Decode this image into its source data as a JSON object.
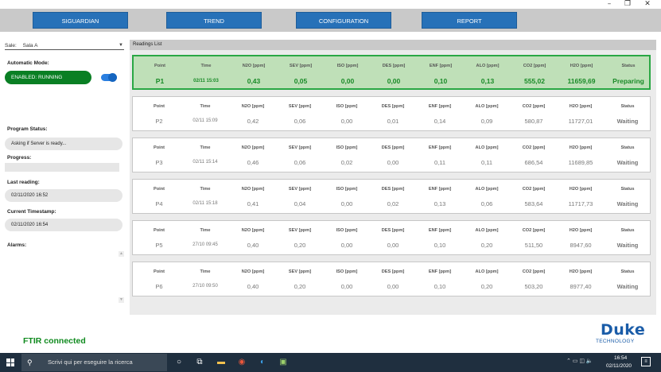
{
  "window": {
    "minimize": "–",
    "maximize": "❐",
    "close": "✕"
  },
  "nav": {
    "siguardian": "SIGUARDIAN",
    "trend": "TREND",
    "configuration": "CONFIGURATION",
    "report": "REPORT"
  },
  "left": {
    "sala_label": "Sale:",
    "sala_value": "Sala A",
    "auto_mode_label": "Automatic Mode:",
    "auto_mode_value": "ENABLED: RUNNING",
    "program_status_label": "Program Status:",
    "program_status_value": "Asking if Server is ready...",
    "progress_label": "Progress:",
    "progress_value": 0,
    "last_reading_label": "Last reading:",
    "last_reading_value": "02/11/2020 16:52",
    "current_ts_label": "Current Timestamp:",
    "current_ts_value": "02/11/2020 16:54",
    "alarms_label": "Alarms:",
    "ftir_status": "FTIR connected"
  },
  "readings": {
    "title": "Readings List",
    "columns": [
      "Point",
      "Time",
      "N2O [ppm]",
      "SEV [ppm]",
      "ISO [ppm]",
      "DES [ppm]",
      "ENF [ppm]",
      "ALO [ppm]",
      "CO2 [ppm]",
      "H2O [ppm]",
      "Status"
    ],
    "rows": [
      {
        "active": true,
        "cells": [
          "P1",
          "02/11 15:03",
          "0,43",
          "0,05",
          "0,00",
          "0,00",
          "0,10",
          "0,13",
          "555,02",
          "11659,69",
          "Preparing"
        ]
      },
      {
        "active": false,
        "cells": [
          "P2",
          "02/11 15:09",
          "0,42",
          "0,06",
          "0,00",
          "0,01",
          "0,14",
          "0,09",
          "580,87",
          "11727,01",
          "Waiting"
        ]
      },
      {
        "active": false,
        "cells": [
          "P3",
          "02/11 15:14",
          "0,46",
          "0,06",
          "0,02",
          "0,00",
          "0,11",
          "0,11",
          "686,54",
          "11689,85",
          "Waiting"
        ]
      },
      {
        "active": false,
        "cells": [
          "P4",
          "02/11 15:18",
          "0,41",
          "0,04",
          "0,00",
          "0,02",
          "0,13",
          "0,06",
          "583,64",
          "11717,73",
          "Waiting"
        ]
      },
      {
        "active": false,
        "cells": [
          "P5",
          "27/10 09:45",
          "0,40",
          "0,20",
          "0,00",
          "0,00",
          "0,10",
          "0,20",
          "511,50",
          "8947,60",
          "Waiting"
        ]
      },
      {
        "active": false,
        "cells": [
          "P6",
          "27/10 09:50",
          "0,40",
          "0,20",
          "0,00",
          "0,00",
          "0,10",
          "0,20",
          "503,20",
          "8977,40",
          "Waiting"
        ]
      }
    ]
  },
  "logo": {
    "main": "Duke",
    "sub": "TECHNOLOGY"
  },
  "taskbar": {
    "search_placeholder": "Scrivi qui per eseguire la ricerca",
    "time": "16:54",
    "date": "02/11/2020"
  },
  "colors": {
    "nav_button": "#2771b8",
    "enabled": "#0a7f24",
    "active_card": "#bfe0b8",
    "ftir": "#0f8a1e"
  }
}
